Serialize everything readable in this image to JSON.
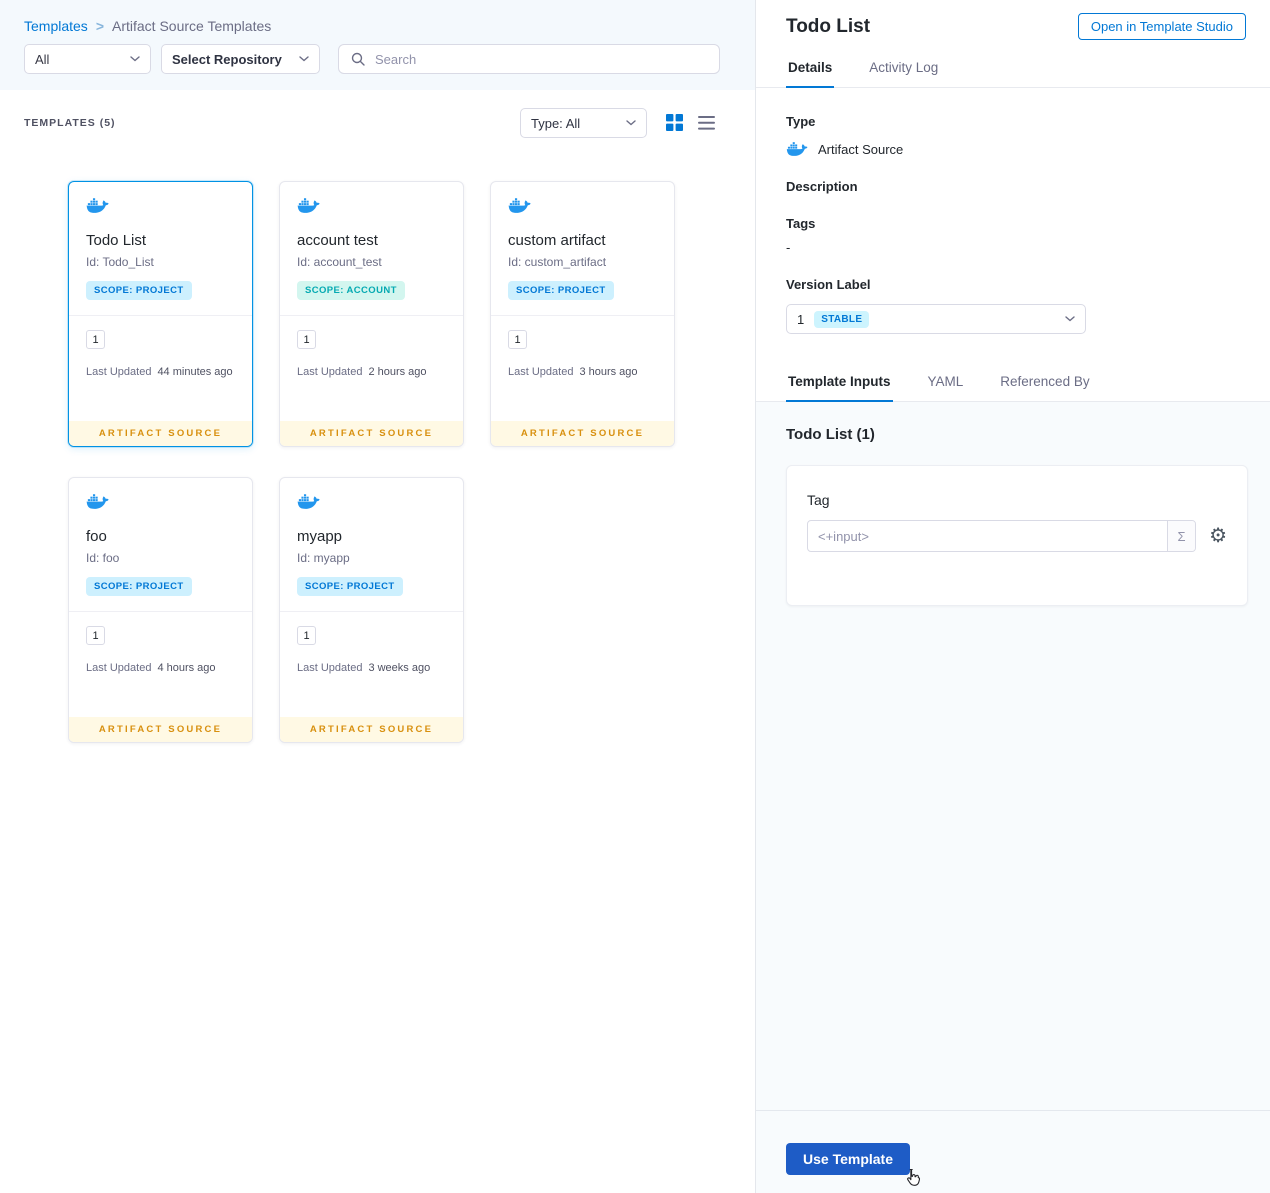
{
  "breadcrumb": {
    "root": "Templates",
    "separator": ">",
    "current": "Artifact Source Templates"
  },
  "filters": {
    "scope": "All",
    "repository": "Select Repository",
    "search_placeholder": "Search"
  },
  "list_header": {
    "count": "TEMPLATES (5)",
    "type_filter": "Type: All"
  },
  "card_labels": {
    "last_updated": "Last Updated",
    "footer": "ARTIFACT SOURCE"
  },
  "cards": [
    {
      "title": "Todo List",
      "id": "Id: Todo_List",
      "scope": "SCOPE: PROJECT",
      "version": "1",
      "updated": "44 minutes ago"
    },
    {
      "title": "account test",
      "id": "Id: account_test",
      "scope": "SCOPE: ACCOUNT",
      "version": "1",
      "updated": "2 hours ago"
    },
    {
      "title": "custom artifact",
      "id": "Id: custom_artifact",
      "scope": "SCOPE: PROJECT",
      "version": "1",
      "updated": "3 hours ago"
    },
    {
      "title": "foo",
      "id": "Id: foo",
      "scope": "SCOPE: PROJECT",
      "version": "1",
      "updated": "4 hours ago"
    },
    {
      "title": "myapp",
      "id": "Id: myapp",
      "scope": "SCOPE: PROJECT",
      "version": "1",
      "updated": "3 weeks ago"
    }
  ],
  "panel": {
    "title": "Todo List",
    "open_studio": "Open in Template Studio",
    "tabs": [
      {
        "label": "Details"
      },
      {
        "label": "Activity Log"
      }
    ],
    "details": {
      "type_label": "Type",
      "type_value": "Artifact Source",
      "description_label": "Description",
      "tags_label": "Tags",
      "tags_value": "-",
      "version_label": "Version Label",
      "version_value": "1",
      "version_badge": "STABLE"
    },
    "inner_tabs": [
      {
        "label": "Template Inputs"
      },
      {
        "label": "YAML"
      },
      {
        "label": "Referenced By"
      }
    ],
    "inputs": {
      "heading": "Todo List (1)",
      "tag_label": "Tag",
      "tag_value": "<+input>"
    },
    "footer": {
      "use_template": "Use Template"
    }
  },
  "icons": {
    "expression": "Σ",
    "gear": "⚙"
  },
  "colors": {
    "accent": "#0278D5",
    "selected_card_border": "#0092E4",
    "scope_project_bg": "#CDF0FE",
    "scope_project_text": "#0278D5",
    "scope_account_bg": "#D3F6EF",
    "scope_account_text": "#05AAB2",
    "artifact_footer_bg": "#FFF9E4",
    "artifact_footer_text": "#D8900F",
    "primary_button": "#1E5CC6",
    "docker_icon": "#2396ED"
  }
}
